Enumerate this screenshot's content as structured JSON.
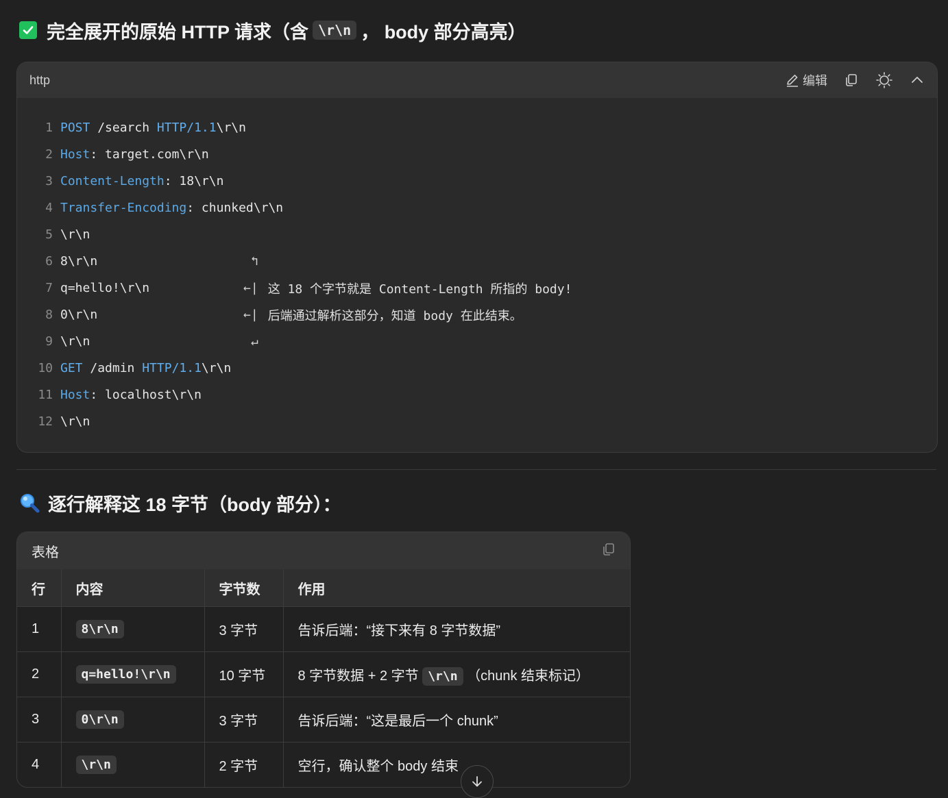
{
  "heading1": {
    "prefix": "完全展开的原始 HTTP 请求（含",
    "code": "\\r\\n",
    "suffix": "，  body 部分高亮）",
    "icon": "check-box-icon",
    "icon_color": "#20c05c"
  },
  "codeblock": {
    "language": "http",
    "edit_label": "编辑",
    "lines": [
      {
        "n": "1",
        "parts": [
          {
            "t": "POST",
            "c": "kw"
          },
          {
            "t": " /search "
          },
          {
            "t": "HTTP/1.1",
            "c": "kw"
          },
          {
            "t": "\\r\\n"
          }
        ]
      },
      {
        "n": "2",
        "parts": [
          {
            "t": "Host",
            "c": "hn"
          },
          {
            "t": ": target.com\\r\\n"
          }
        ]
      },
      {
        "n": "3",
        "parts": [
          {
            "t": "Content-Length",
            "c": "hn"
          },
          {
            "t": ": 18\\r\\n"
          }
        ]
      },
      {
        "n": "4",
        "parts": [
          {
            "t": "Transfer-Encoding",
            "c": "hn"
          },
          {
            "t": ": chunked\\r\\n"
          }
        ]
      },
      {
        "n": "5",
        "parts": [
          {
            "t": "\\r\\n"
          }
        ]
      },
      {
        "n": "6",
        "parts": [
          {
            "t": "8\\r\\n"
          }
        ],
        "arrow": " ↰",
        "note": ""
      },
      {
        "n": "7",
        "parts": [
          {
            "t": "q=hello!\\r\\n"
          }
        ],
        "arrow": "←|",
        "note": "这 18 个字节就是 Content-Length 所指的 body!"
      },
      {
        "n": "8",
        "parts": [
          {
            "t": "0\\r\\n"
          }
        ],
        "arrow": "←|",
        "note": "后端通过解析这部分，知道 body 在此结束。"
      },
      {
        "n": "9",
        "parts": [
          {
            "t": "\\r\\n"
          }
        ],
        "arrow": " ↵",
        "note": ""
      },
      {
        "n": "10",
        "parts": [
          {
            "t": "GET",
            "c": "kw"
          },
          {
            "t": " /admin "
          },
          {
            "t": "HTTP/1.1",
            "c": "kw"
          },
          {
            "t": "\\r\\n"
          }
        ]
      },
      {
        "n": "11",
        "parts": [
          {
            "t": "Host",
            "c": "hn"
          },
          {
            "t": ": localhost\\r\\n"
          }
        ]
      },
      {
        "n": "12",
        "parts": [
          {
            "t": "\\r\\n"
          }
        ]
      }
    ]
  },
  "heading2": {
    "text": "逐行解释这 18 字节（body 部分）：",
    "icon": "magnifier-icon"
  },
  "table": {
    "title": "表格",
    "columns": [
      "行",
      "内容",
      "字节数",
      "作用"
    ],
    "rows": [
      {
        "row": "1",
        "content": "8\\r\\n",
        "bytes": "3 字节",
        "effect": [
          {
            "t": "告诉后端：“接下来有 8 字节数据”"
          }
        ]
      },
      {
        "row": "2",
        "content": "q=hello!\\r\\n",
        "bytes": "10 字节",
        "effect": [
          {
            "t": "8 字节数据 + 2 字节 "
          },
          {
            "t": "\\r\\n",
            "code": true
          },
          {
            "t": " （chunk 结束标记）"
          }
        ]
      },
      {
        "row": "3",
        "content": "0\\r\\n",
        "bytes": "3 字节",
        "effect": [
          {
            "t": "告诉后端：“这是最后一个 chunk”"
          }
        ]
      },
      {
        "row": "4",
        "content": "\\r\\n",
        "bytes": "2 字节",
        "effect": [
          {
            "t": "空行，确认整个 body 结束"
          }
        ]
      }
    ]
  }
}
